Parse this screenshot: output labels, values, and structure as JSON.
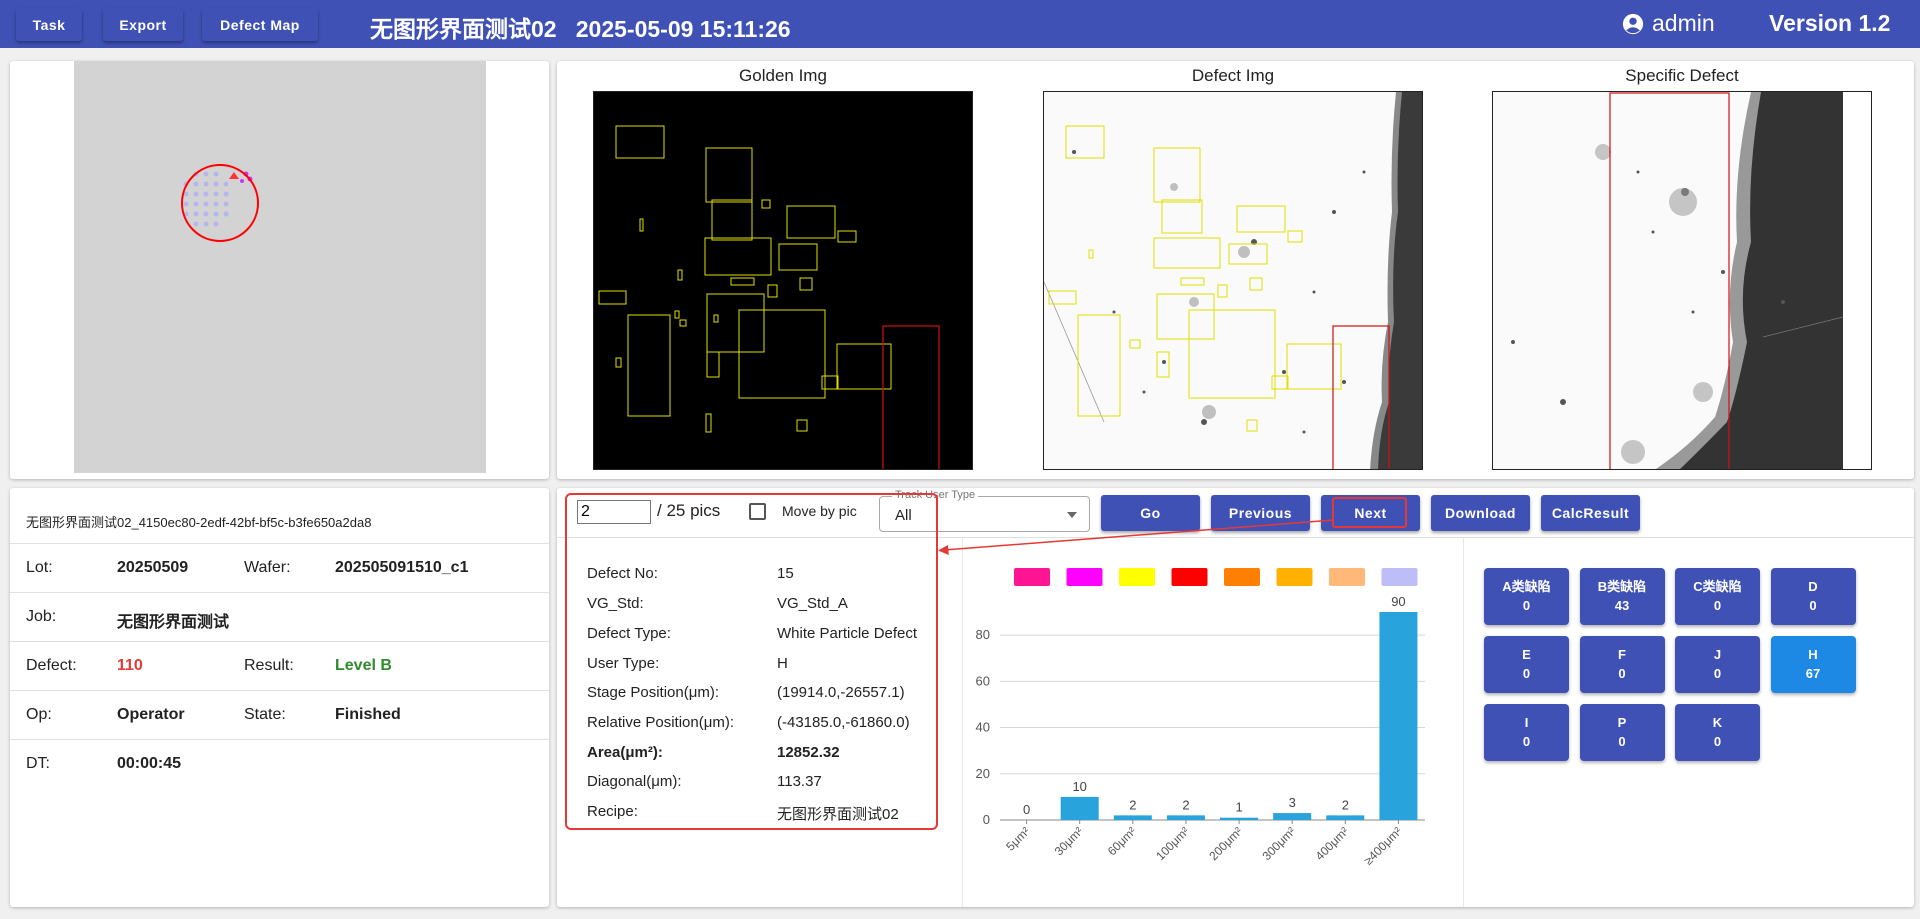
{
  "header": {
    "task_label": "Task",
    "export_label": "Export",
    "defect_map_label": "Defect Map",
    "title": "无图形界面测试02   2025-05-09 15:11:26",
    "user": "admin",
    "version": "Version 1.2"
  },
  "images": {
    "golden_caption": "Golden Img",
    "defect_caption": "Defect Img",
    "specific_caption": "Specific Defect"
  },
  "info": {
    "id": "无图形界面测试02_4150ec80-2edf-42bf-bf5c-b3fe650a2da8",
    "lot_label": "Lot:",
    "lot_value": "20250509",
    "wafer_label": "Wafer:",
    "wafer_value": "202505091510_c1",
    "job_label": "Job:",
    "job_value": "无图形界面测试",
    "defect_label": "Defect:",
    "defect_value": "110",
    "result_label": "Result:",
    "result_value": "Level B",
    "op_label": "Op:",
    "op_value": "Operator",
    "state_label": "State:",
    "state_value": "Finished",
    "dt_label": "DT:",
    "dt_value": "00:00:45"
  },
  "controls": {
    "page_input": "2",
    "page_total": "/ 25 pics",
    "move_by_pic": "Move by pic",
    "track_label": "Track User Type",
    "track_value": "All",
    "go": "Go",
    "previous": "Previous",
    "next": "Next",
    "download": "Download",
    "calc": "CalcResult"
  },
  "detail": {
    "defect_no_label": "Defect No:",
    "defect_no": "15",
    "vg_std_label": "VG_Std:",
    "vg_std": "VG_Std_A",
    "defect_type_label": "Defect Type:",
    "defect_type": "White Particle Defect",
    "user_type_label": "User Type:",
    "user_type": "H",
    "stage_pos_label": "Stage Position(μm):",
    "stage_pos": "(19914.0,-26557.1)",
    "rel_pos_label": "Relative Position(μm):",
    "rel_pos": "(-43185.0,-61860.0)",
    "area_label": "Area(μm²):",
    "area": "12852.32",
    "diagonal_label": "Diagonal(μm):",
    "diagonal": "113.37",
    "recipe_label": "Recipe:",
    "recipe": "无图形界面测试02"
  },
  "chart_data": {
    "type": "bar",
    "categories": [
      "5μm²",
      "30μm²",
      "60μm²",
      "100μm²",
      "200μm²",
      "300μm²",
      "400μm²",
      "≥400μm²"
    ],
    "values": [
      0,
      10,
      2,
      2,
      1,
      3,
      2,
      90
    ],
    "ylim": [
      0,
      90
    ],
    "yticks": [
      0,
      20,
      40,
      60,
      80
    ],
    "bar_color": "#29a3dc",
    "legend_colors": [
      "#ff1493",
      "#ff00ff",
      "#ffff00",
      "#ff0000",
      "#ff8000",
      "#ffb000",
      "#ffb878",
      "#bdbdf8"
    ],
    "grid": true
  },
  "categories": [
    {
      "label": "A类缺陷",
      "count": "0"
    },
    {
      "label": "B类缺陷",
      "count": "43"
    },
    {
      "label": "C类缺陷",
      "count": "0"
    },
    {
      "label": "D",
      "count": "0"
    },
    {
      "label": "E",
      "count": "0"
    },
    {
      "label": "F",
      "count": "0"
    },
    {
      "label": "J",
      "count": "0"
    },
    {
      "label": "H",
      "count": "67"
    },
    {
      "label": "I",
      "count": "0"
    },
    {
      "label": "P",
      "count": "0"
    },
    {
      "label": "K",
      "count": "0"
    }
  ],
  "colors": {
    "primary": "#3f51b5",
    "active_category": "#1e88e5",
    "defect_red": "#e53935",
    "level_green": "#2e8b2e"
  }
}
